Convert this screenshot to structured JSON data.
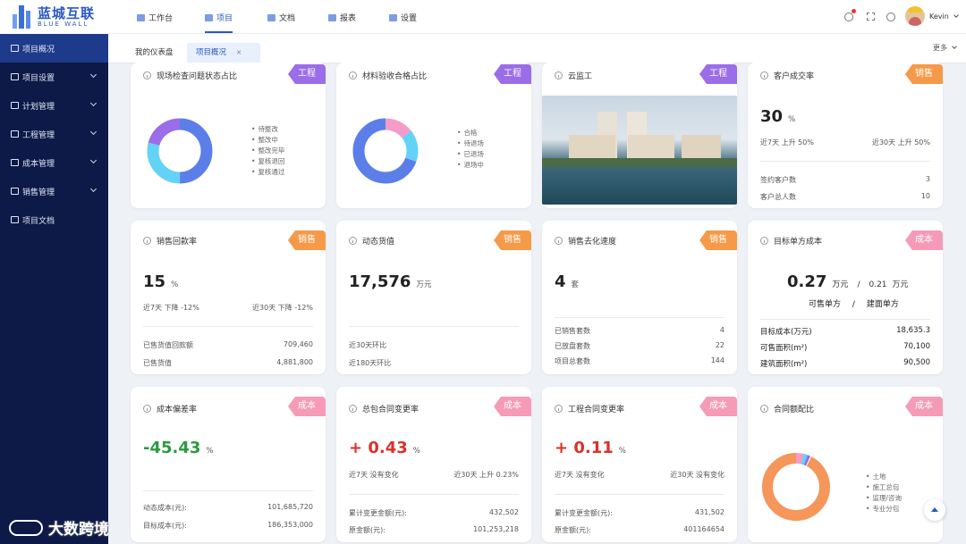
{
  "brand": {
    "name": "蓝城互联",
    "sub": "BLUE WALL"
  },
  "sidebar": [
    {
      "label": "项目概况",
      "active": true,
      "chev": false
    },
    {
      "label": "项目设置",
      "chev": true
    },
    {
      "label": "计划管理",
      "chev": true
    },
    {
      "label": "工程管理",
      "chev": true
    },
    {
      "label": "成本管理",
      "chev": true
    },
    {
      "label": "销售管理",
      "chev": true
    },
    {
      "label": "项目文档",
      "chev": false
    }
  ],
  "topnav": [
    {
      "label": "工作台"
    },
    {
      "label": "项目",
      "active": true
    },
    {
      "label": "文档"
    },
    {
      "label": "报表"
    },
    {
      "label": "设置"
    }
  ],
  "user": {
    "name": "Kevin"
  },
  "tabs": {
    "dashboard": "我的仪表盘",
    "overview": "项目概况",
    "close": "×",
    "more": "更多"
  },
  "cards": {
    "c1": {
      "title": "现场检查问题状态占比",
      "tag": "工程",
      "legend": [
        "待整改",
        "整改中",
        "整改完毕",
        "复核退回",
        "复核通过"
      ]
    },
    "c2": {
      "title": "材料验收合格占比",
      "tag": "工程",
      "legend": [
        "合格",
        "待退场",
        "已退场",
        "退场中"
      ]
    },
    "c3": {
      "title": "云监工",
      "tag": "工程"
    },
    "c4": {
      "title": "客户成交率",
      "tag": "销售",
      "value": "30",
      "unit": "%",
      "l7": "近7天 上升 50%",
      "l30": "近30天 上升 50%",
      "rows": [
        [
          "签约客户数",
          "3"
        ],
        [
          "客户总人数",
          "10"
        ]
      ]
    },
    "c5": {
      "title": "销售回款率",
      "tag": "销售",
      "value": "15",
      "unit": "%",
      "l7": "近7天 下降 -12%",
      "l30": "近30天 下降 -12%",
      "rows": [
        [
          "已售货值回款额",
          "709,460"
        ],
        [
          "已售货值",
          "4,881,800"
        ]
      ]
    },
    "c6": {
      "title": "动态货值",
      "tag": "销售",
      "value": "17,576",
      "unit": "万元",
      "rows": [
        [
          "近30天环比",
          ""
        ],
        [
          "近180天环比",
          ""
        ]
      ]
    },
    "c7": {
      "title": "销售去化速度",
      "tag": "销售",
      "value": "4",
      "unit": "套",
      "rows": [
        [
          "已销售套数",
          "4"
        ],
        [
          "已放盘套数",
          "22"
        ],
        [
          "项目总套数",
          "144"
        ]
      ]
    },
    "c8": {
      "title": "目标单方成本",
      "tag": "成本",
      "v1": "0.27",
      "u1": "万元",
      "sep": "/",
      "v2": "0.21",
      "u2": "万元",
      "lab1": "可售单方",
      "lab2": "建面单方",
      "rows": [
        [
          "目标成本(万元)",
          "18,635.3"
        ],
        [
          "可售面积(m²)",
          "70,100"
        ],
        [
          "建筑面积(m²)",
          "90,500"
        ]
      ]
    },
    "c9": {
      "title": "成本偏差率",
      "tag": "成本",
      "value": "-45.43",
      "unit": "%",
      "rows": [
        [
          "动态成本(元):",
          "101,685,720"
        ],
        [
          "目标成本(元):",
          "186,353,000"
        ]
      ]
    },
    "c10": {
      "title": "总包合同变更率",
      "tag": "成本",
      "value": "+ 0.43",
      "unit": "%",
      "l7": "近7天 没有变化",
      "l30": "近30天 上升 0.23%",
      "rows": [
        [
          "累计变更金额(元):",
          "432,502"
        ],
        [
          "原金额(元):",
          "101,253,218"
        ]
      ]
    },
    "c11": {
      "title": "工程合同变更率",
      "tag": "成本",
      "value": "+ 0.11",
      "unit": "%",
      "l7": "近7天 没有变化",
      "l30": "近30天 没有变化",
      "rows": [
        [
          "累计变更金额(元):",
          "431,502"
        ],
        [
          "原金额(元):",
          "401164654"
        ]
      ]
    },
    "c12": {
      "title": "合同额配比",
      "tag": "成本",
      "legend": [
        "土地",
        "施工总包",
        "监理/咨询",
        "专业分包"
      ]
    }
  },
  "watermark": "大数跨境"
}
